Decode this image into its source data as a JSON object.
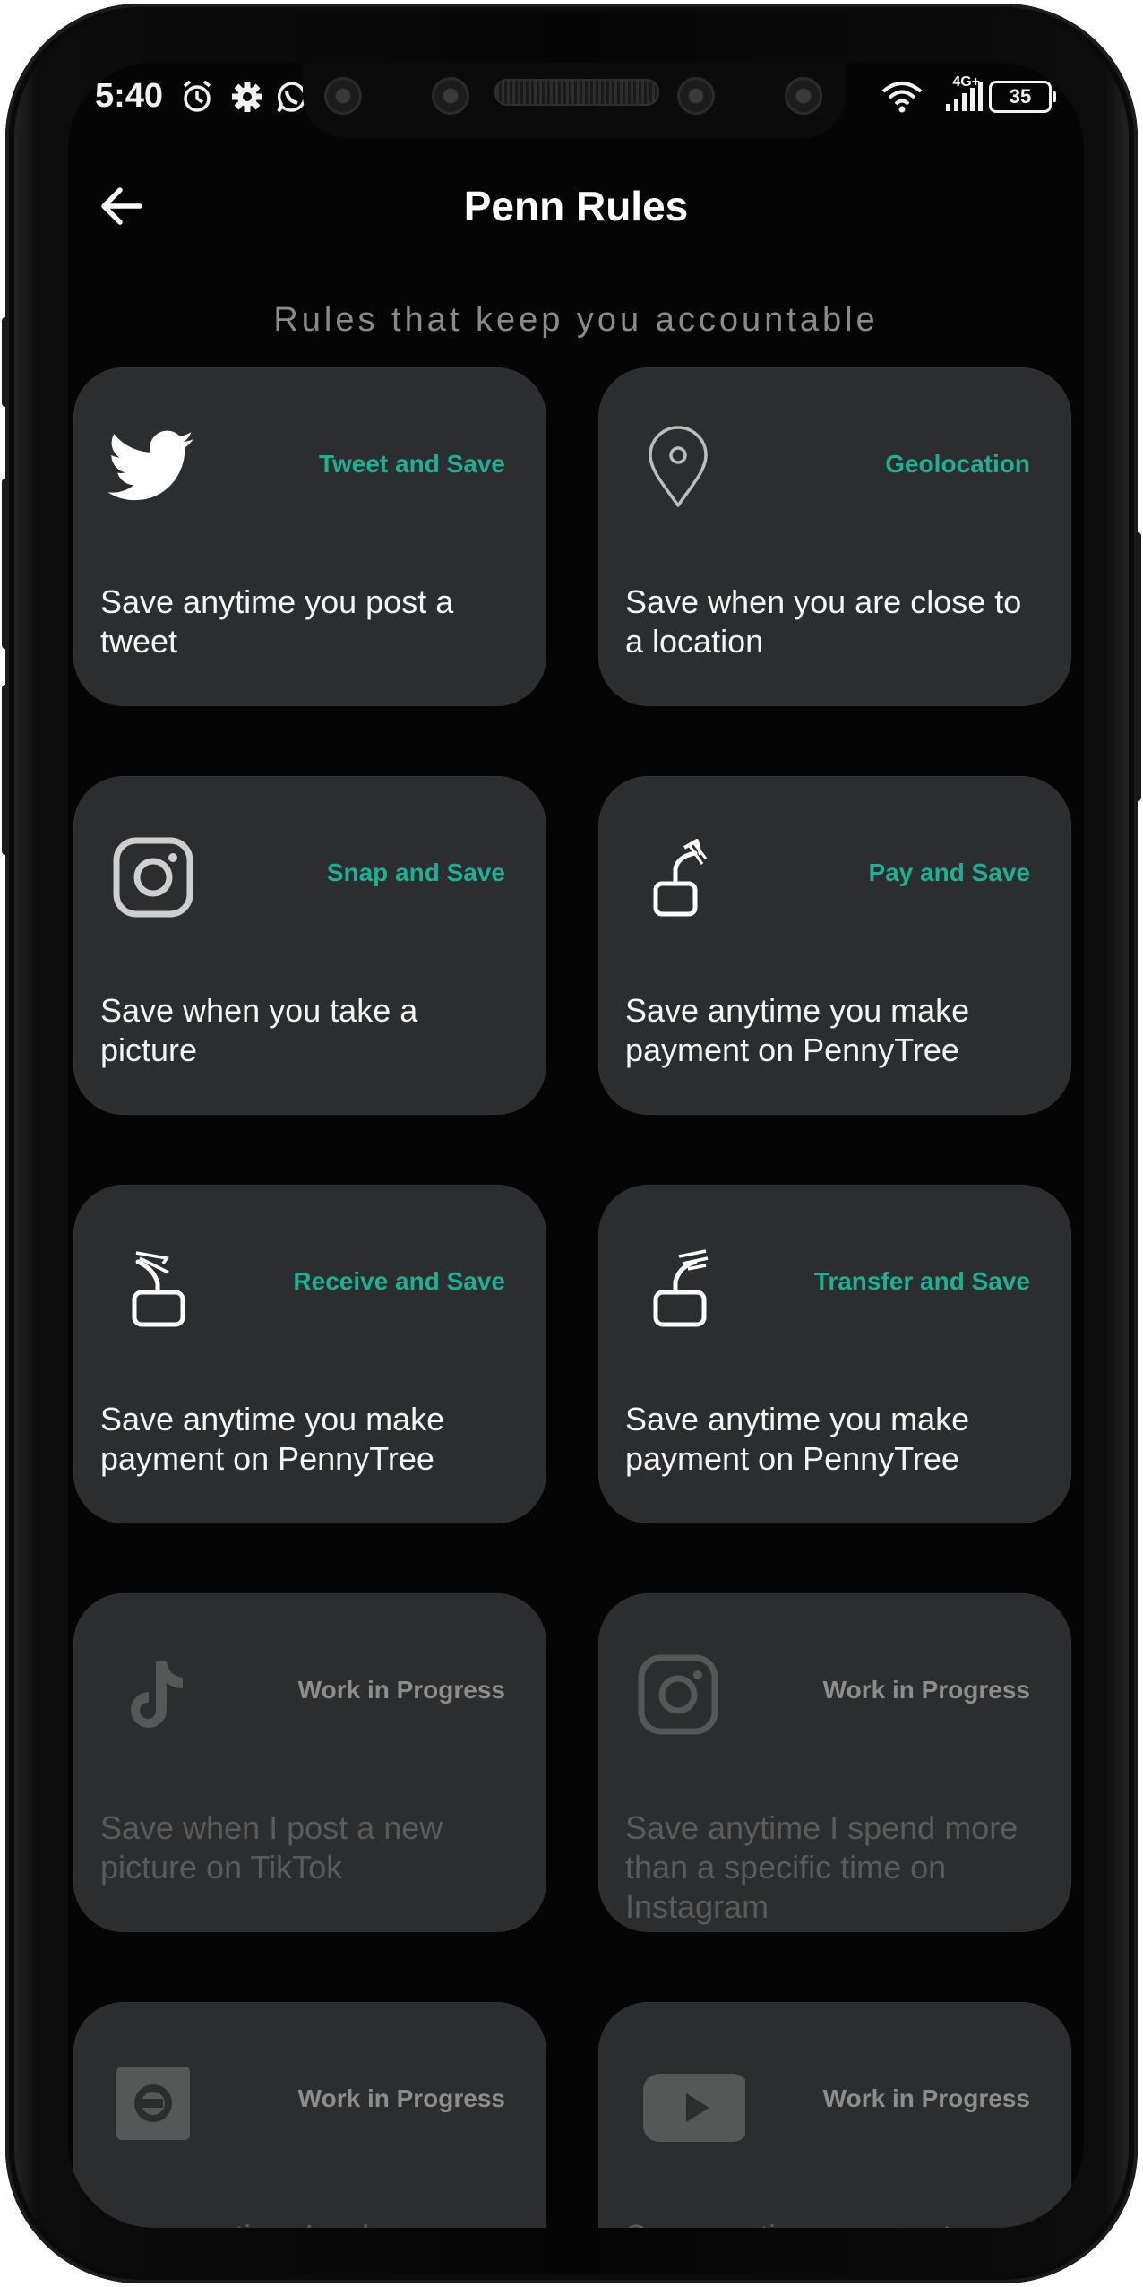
{
  "status_bar": {
    "time": "5:40",
    "network": "4G+",
    "battery": "35"
  },
  "header": {
    "title": "Penn Rules"
  },
  "subtitle": "Rules that keep you accountable",
  "colors": {
    "accent": "#1fae96",
    "card_bg": "#2c2d2e",
    "screen_bg": "#050505",
    "wip_text": "#8d8d8d"
  },
  "cards": [
    {
      "tag": "Tweet and Save",
      "description": "Save anytime you post a tweet",
      "icon": "twitter-icon",
      "enabled": true
    },
    {
      "tag": "Geolocation",
      "description": "Save when you are close to a location",
      "icon": "location-pin-icon",
      "enabled": true
    },
    {
      "tag": "Snap and Save",
      "description": "Save when you take a picture",
      "icon": "instagram-icon",
      "enabled": true
    },
    {
      "tag": "Pay and Save",
      "description": "Save anytime you make payment on PennyTree",
      "icon": "pay-icon",
      "enabled": true
    },
    {
      "tag": "Receive and Save",
      "description": "Save anytime you make payment on PennyTree",
      "icon": "receive-icon",
      "enabled": true
    },
    {
      "tag": "Transfer and Save",
      "description": "Save anytime you make payment on PennyTree",
      "icon": "transfer-icon",
      "enabled": true
    },
    {
      "tag": "Work in Progress",
      "description": "Save when I post a new picture on TikTok",
      "icon": "tiktok-icon",
      "enabled": false
    },
    {
      "tag": "Work in Progress",
      "description": "Save anytime I spend more than a specific time on Instagram",
      "icon": "instagram-icon",
      "enabled": false
    },
    {
      "tag": "Work in Progress",
      "description": "Save anytime I order on",
      "icon": "uber-icon",
      "enabled": false
    },
    {
      "tag": "Work in Progress",
      "description": "Save anytime you post a",
      "icon": "youtube-icon",
      "enabled": false
    }
  ]
}
